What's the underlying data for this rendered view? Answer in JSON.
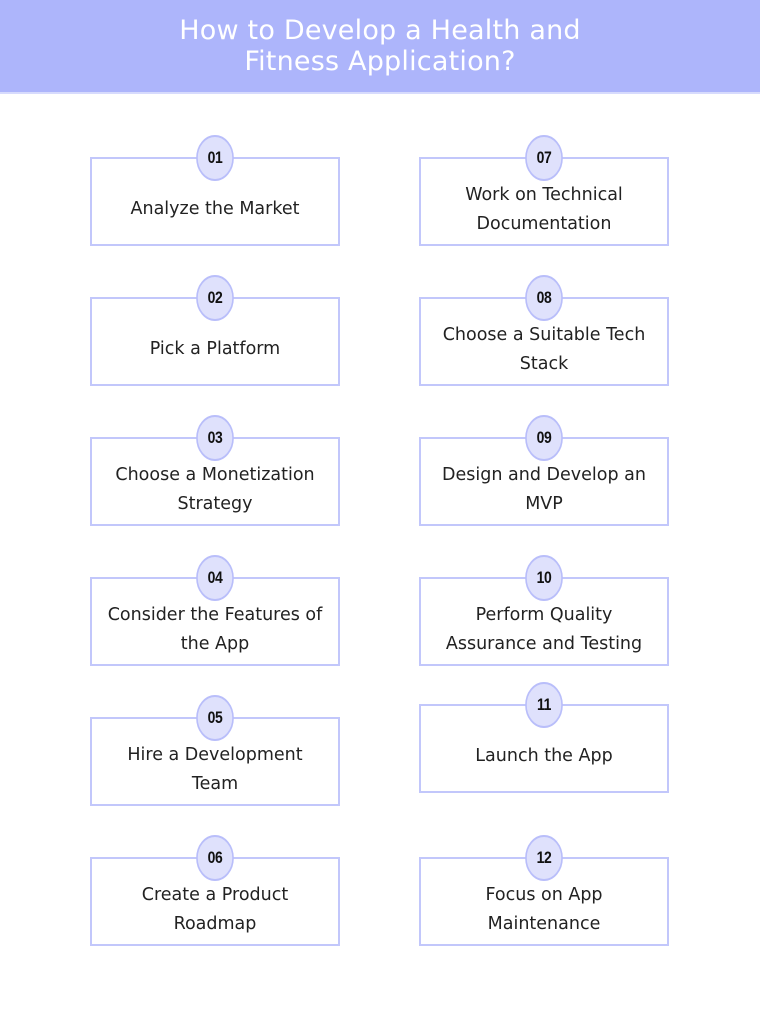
{
  "header": {
    "title": "How to Develop a Health and Fitness Application?"
  },
  "colors": {
    "header_bg": "#adb5fb",
    "box_border": "#c2c7fb",
    "badge_fill": "#dfe1fc",
    "badge_border": "#b9befa",
    "text": "#222222"
  },
  "steps": [
    {
      "number": "01",
      "label": "Analyze the Market"
    },
    {
      "number": "02",
      "label": "Pick a Platform"
    },
    {
      "number": "03",
      "label": "Choose a Monetization Strategy"
    },
    {
      "number": "04",
      "label": "Consider the Features of the App"
    },
    {
      "number": "05",
      "label": "Hire a Development Team"
    },
    {
      "number": "06",
      "label": "Create a Product Roadmap"
    },
    {
      "number": "07",
      "label": "Work on Technical Documentation"
    },
    {
      "number": "08",
      "label": "Choose a Suitable Tech Stack"
    },
    {
      "number": "09",
      "label": "Design and Develop an MVP"
    },
    {
      "number": "10",
      "label": "Perform Quality Assurance and Testing"
    },
    {
      "number": "11",
      "label": "Launch the App"
    },
    {
      "number": "12",
      "label": "Focus on App Maintenance"
    }
  ]
}
